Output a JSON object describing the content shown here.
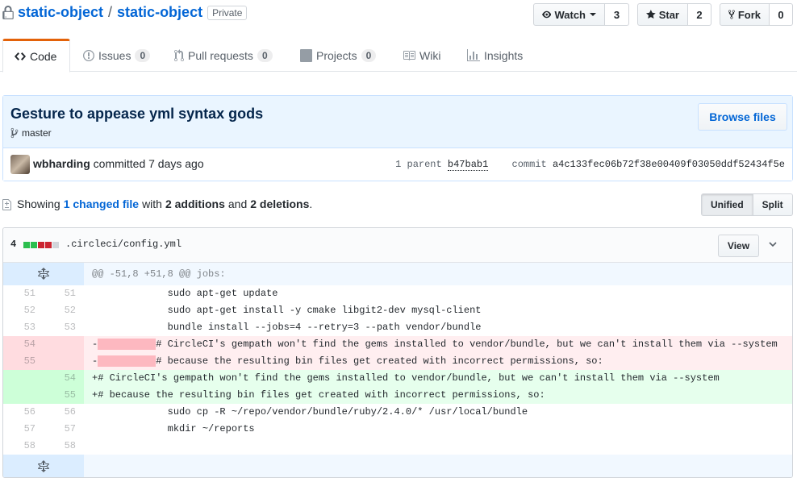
{
  "repo": {
    "owner": "static-object",
    "separator": "/",
    "name": "static-object",
    "visibility": "Private"
  },
  "actions": {
    "watch_label": "Watch",
    "watch_count": "3",
    "star_label": "Star",
    "star_count": "2",
    "fork_label": "Fork",
    "fork_count": "0"
  },
  "tabs": [
    {
      "label": "Code",
      "icon": "code-icon"
    },
    {
      "label": "Issues",
      "count": "0",
      "icon": "issue-icon"
    },
    {
      "label": "Pull requests",
      "count": "0",
      "icon": "pull-request-icon"
    },
    {
      "label": "Projects",
      "count": "0",
      "icon": "project-icon"
    },
    {
      "label": "Wiki",
      "icon": "book-icon"
    },
    {
      "label": "Insights",
      "icon": "graph-icon"
    }
  ],
  "commit": {
    "title": "Gesture to appease yml syntax gods",
    "branch": "master",
    "browse_label": "Browse files",
    "author": "wbharding",
    "action_text": "committed 7 days ago",
    "parent_label": "1 parent",
    "parent_sha": "b47bab1",
    "commit_label": "commit",
    "commit_sha": "a4c133fec06b72f38e00409f03050ddf52434f5e"
  },
  "toc": {
    "showing": "Showing",
    "changed_files": "1 changed file",
    "with": "with",
    "additions": "2 additions",
    "and": "and",
    "deletions": "2 deletions",
    "period": ".",
    "unified_label": "Unified",
    "split_label": "Split"
  },
  "file": {
    "diffstat": "4",
    "name": ".circleci/config.yml",
    "view_label": "View",
    "colors": {
      "add": "#2cbe4e",
      "del": "#cb2431",
      "neutral": "#d1d5da"
    }
  },
  "diff": {
    "hunk_header": "@@ -51,8 +51,8 @@ jobs:",
    "lines": [
      {
        "type": "ctx",
        "old": "51",
        "new": "51",
        "text": "             sudo apt-get update"
      },
      {
        "type": "ctx",
        "old": "52",
        "new": "52",
        "text": "             sudo apt-get install -y cmake libgit2-dev mysql-client"
      },
      {
        "type": "ctx",
        "old": "53",
        "new": "53",
        "text": "             bundle install --jobs=4 --retry=3 --path vendor/bundle"
      },
      {
        "type": "del",
        "old": "54",
        "new": "",
        "prefix": "-",
        "text": "# CircleCI's gempath won't find the gems installed to vendor/bundle, but we can't install them via --system"
      },
      {
        "type": "del",
        "old": "55",
        "new": "",
        "prefix": "-",
        "text": "# because the resulting bin files get created with incorrect permissions, so:"
      },
      {
        "type": "add",
        "old": "",
        "new": "54",
        "text": "+# CircleCI's gempath won't find the gems installed to vendor/bundle, but we can't install them via --system"
      },
      {
        "type": "add",
        "old": "",
        "new": "55",
        "text": "+# because the resulting bin files get created with incorrect permissions, so:"
      },
      {
        "type": "ctx",
        "old": "56",
        "new": "56",
        "text": "             sudo cp -R ~/repo/vendor/bundle/ruby/2.4.0/* /usr/local/bundle"
      },
      {
        "type": "ctx",
        "old": "57",
        "new": "57",
        "text": "             mkdir ~/reports"
      },
      {
        "type": "ctx",
        "old": "58",
        "new": "58",
        "text": ""
      }
    ]
  }
}
